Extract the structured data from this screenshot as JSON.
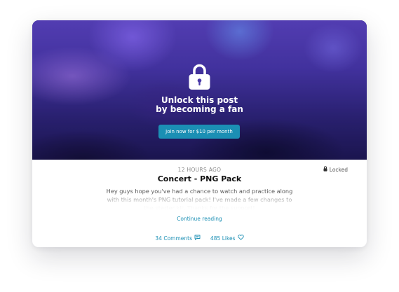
{
  "hero": {
    "title_line1": "Unlock this post",
    "title_line2": "by becoming a fan",
    "join_button_label": "Join now for $10 per month",
    "lock_icon": "lock-icon"
  },
  "post": {
    "timestamp": "12 HOURS AGO",
    "locked_label": "Locked",
    "title": "Concert - PNG Pack",
    "excerpt": "Hey guys hope you've had a chance to watch and practice along with this month's PNG tutorial pack! I've made a few changes to the starter kit. Thanks for the support!",
    "continue_label": "Continue reading"
  },
  "stats": {
    "comments_label": "34 Comments",
    "likes_label": "485 Likes"
  },
  "colors": {
    "accent": "#1b8fb4",
    "title": "#111111",
    "muted": "#8a8a8a"
  }
}
